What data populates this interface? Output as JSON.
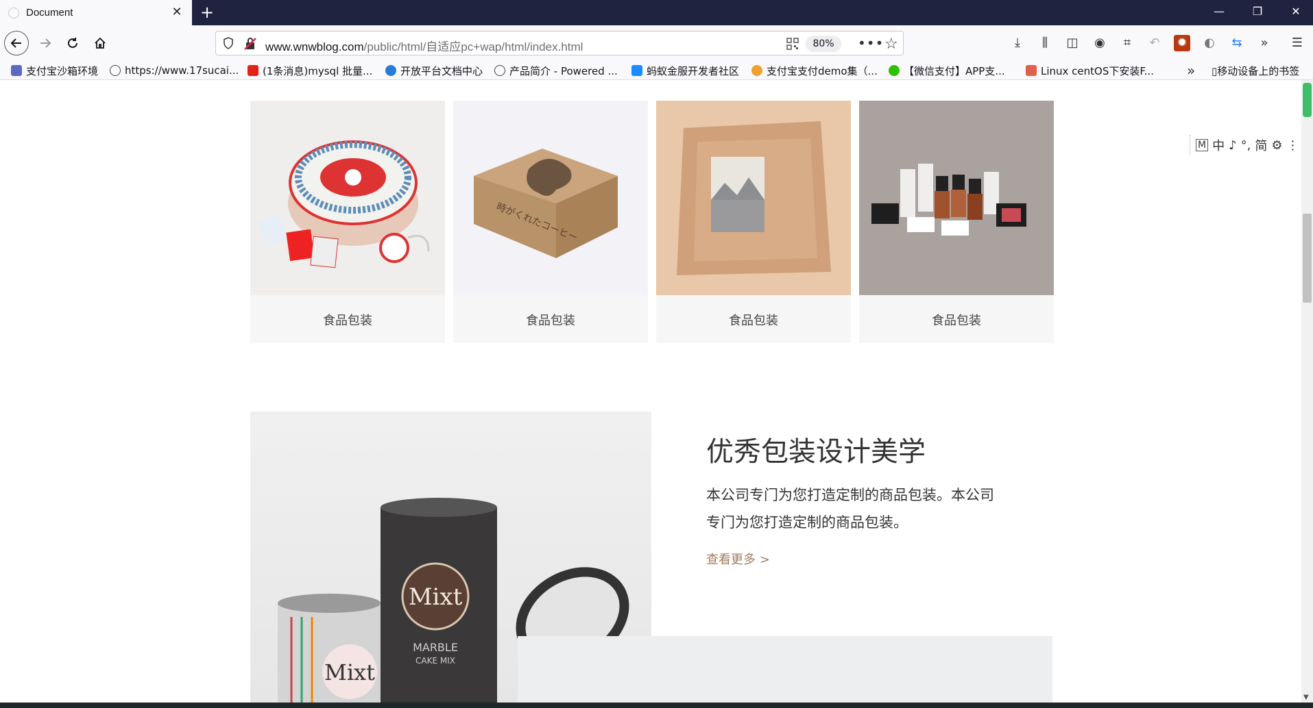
{
  "browser": {
    "tab": {
      "title": "Document",
      "close_glyph": "✕"
    },
    "newtab_glyph": "+",
    "window_controls": {
      "minimize": "—",
      "restore": "❐",
      "close": "✕"
    },
    "url": {
      "host": "www.wnwblog.com",
      "path": "/public/html/自适应pc+wap/html/index.html"
    },
    "zoom": "80%",
    "bookmarks": [
      {
        "label": "支付宝沙箱环境",
        "icon": "robot-icon",
        "color": "#5b6abf"
      },
      {
        "label": "https://www.17sucai...",
        "icon": "globe-icon",
        "color": "#444444"
      },
      {
        "label": "(1条消息)mysql 批量...",
        "icon": "csdn-icon",
        "color": "#e2231a"
      },
      {
        "label": "开放平台文档中心",
        "icon": "figure-icon",
        "color": "#2a7ad8"
      },
      {
        "label": "产品简介 - Powered ...",
        "icon": "globe-icon",
        "color": "#444444"
      },
      {
        "label": "蚂蚁金服开发者社区",
        "icon": "ant-icon",
        "color": "#1a8cff"
      },
      {
        "label": "支付宝支付demo集（...",
        "icon": "cat-icon",
        "color": "#f0a030"
      },
      {
        "label": "【微信支付】APP支...",
        "icon": "wechat-icon",
        "color": "#2dc100"
      },
      {
        "label": "Linux centOS下安装F...",
        "icon": "jian-icon",
        "color": "#e0604a"
      }
    ],
    "bookmarks_more": "»",
    "mobile_bookmarks": "移动设备上的书签"
  },
  "ime_toolbar": {
    "items": [
      "M",
      "中",
      "♪",
      "°,",
      "简",
      "⚙",
      "⋮"
    ]
  },
  "products": [
    {
      "label": "食品包装",
      "image": "tin-box-photo"
    },
    {
      "label": "食品包装",
      "image": "kraft-box-photo"
    },
    {
      "label": "食品包装",
      "image": "paper-wrap-photo"
    },
    {
      "label": "食品包装",
      "image": "cosmetics-photo"
    }
  ],
  "feature": {
    "title": "优秀包装设计美学",
    "description": "本公司专门为您打造定制的商品包装。本公司专门为您打造定制的商品包装。",
    "more_link": "查看更多 >",
    "can_text_1": "Mixt",
    "can_text_2": "MARBLE",
    "can_text_3": "CAKE MIX",
    "can_text_4": "Mixt"
  },
  "colors": {
    "tabstrip": "#202340",
    "toolbar": "#f9f9fb",
    "card_bg": "#f6f6f6",
    "accent_link": "#a07e62"
  }
}
